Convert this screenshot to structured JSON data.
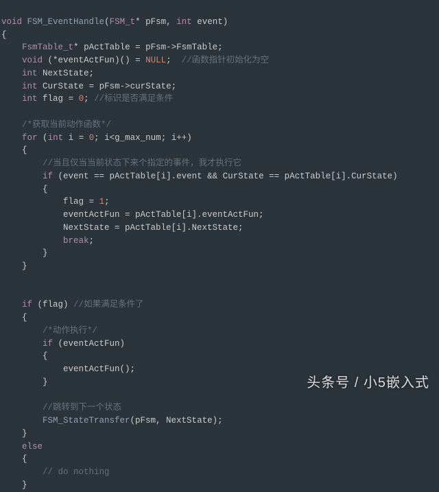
{
  "code": {
    "l01": {
      "kw1": "void",
      "fn": "FSM_EventHandle",
      "p": "(",
      "t1": "FSM_t",
      "star": "*",
      "a1": "pFsm",
      "c1": ",",
      "t2": "int",
      "a2": "event",
      "p2": ")"
    },
    "l02": "{",
    "l03": {
      "t": "FsmTable_t",
      "star": "*",
      "v": "pActTable",
      "eq": "=",
      "rhs": "pFsm->FsmTable;"
    },
    "l04": {
      "t": "void",
      "sig": "(*eventActFun)()",
      "eq": "=",
      "null": "NULL",
      "semi": ";",
      "cm": "//函数指针初始化为空"
    },
    "l05": {
      "t": "int",
      "v": "NextState;"
    },
    "l06": {
      "t": "int",
      "v": "CurState",
      "eq": "=",
      "rhs": "pFsm->curState;"
    },
    "l07": {
      "t": "int",
      "v": "flag",
      "eq": "=",
      "n": "0",
      "semi": ";",
      "cm": "//标识是否满足条件"
    },
    "l09": {
      "cm": "/*获取当前动作函数*/"
    },
    "l10": {
      "kw": "for",
      "p": "(",
      "t": "int",
      "v": "i",
      "eq": "=",
      "n": "0",
      "rest": "; i<g_max_num; i++)"
    },
    "l11": "{",
    "l12": {
      "cm": "//当且仅当当前状态下来个指定的事件，我才执行它"
    },
    "l13": {
      "kw": "if",
      "cond": "(event == pActTable[i].event && CurState == pActTable[i].CurState)"
    },
    "l14": "{",
    "l15": {
      "lhs": "flag",
      "eq": "=",
      "n": "1",
      "semi": ";"
    },
    "l16": {
      "stmt": "eventActFun = pActTable[i].eventActFun;"
    },
    "l17": {
      "stmt": "NextState = pActTable[i].NextState;"
    },
    "l18": {
      "kw": "break",
      "semi": ";"
    },
    "l19": "}",
    "l20": "}",
    "l23": {
      "kw": "if",
      "cond": "(flag)",
      "cm": "//如果满足条件了"
    },
    "l24": "{",
    "l25": {
      "cm": "/*动作执行*/"
    },
    "l26": {
      "kw": "if",
      "cond": "(eventActFun)"
    },
    "l27": "{",
    "l28": {
      "call": "eventActFun();"
    },
    "l29": "}",
    "l31": {
      "cm": "//跳转到下一个状态"
    },
    "l32": {
      "fn": "FSM_StateTransfer",
      "args": "(pFsm, NextState);"
    },
    "l33": "}",
    "l34": {
      "kw": "else"
    },
    "l35": "{",
    "l36": {
      "cm": "// do nothing"
    },
    "l37": "}"
  },
  "watermark": "头条号 / 小5嵌入式"
}
